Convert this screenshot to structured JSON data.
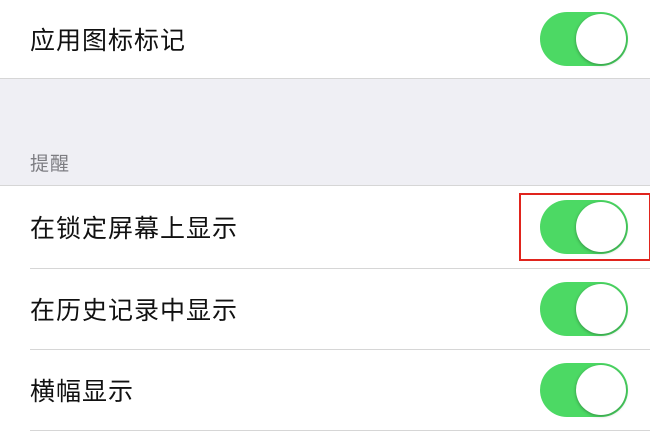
{
  "rows": [
    {
      "label": "应用图标标记",
      "toggle_on": true
    },
    {
      "label": "在锁定屏幕上显示",
      "toggle_on": true
    },
    {
      "label": "在历史记录中显示",
      "toggle_on": true
    },
    {
      "label": "横幅显示",
      "toggle_on": true
    }
  ],
  "section_header": "提醒",
  "colors": {
    "toggle_on": "#4cd964",
    "section_bg": "#efeff4",
    "highlight": "#e0241d"
  }
}
